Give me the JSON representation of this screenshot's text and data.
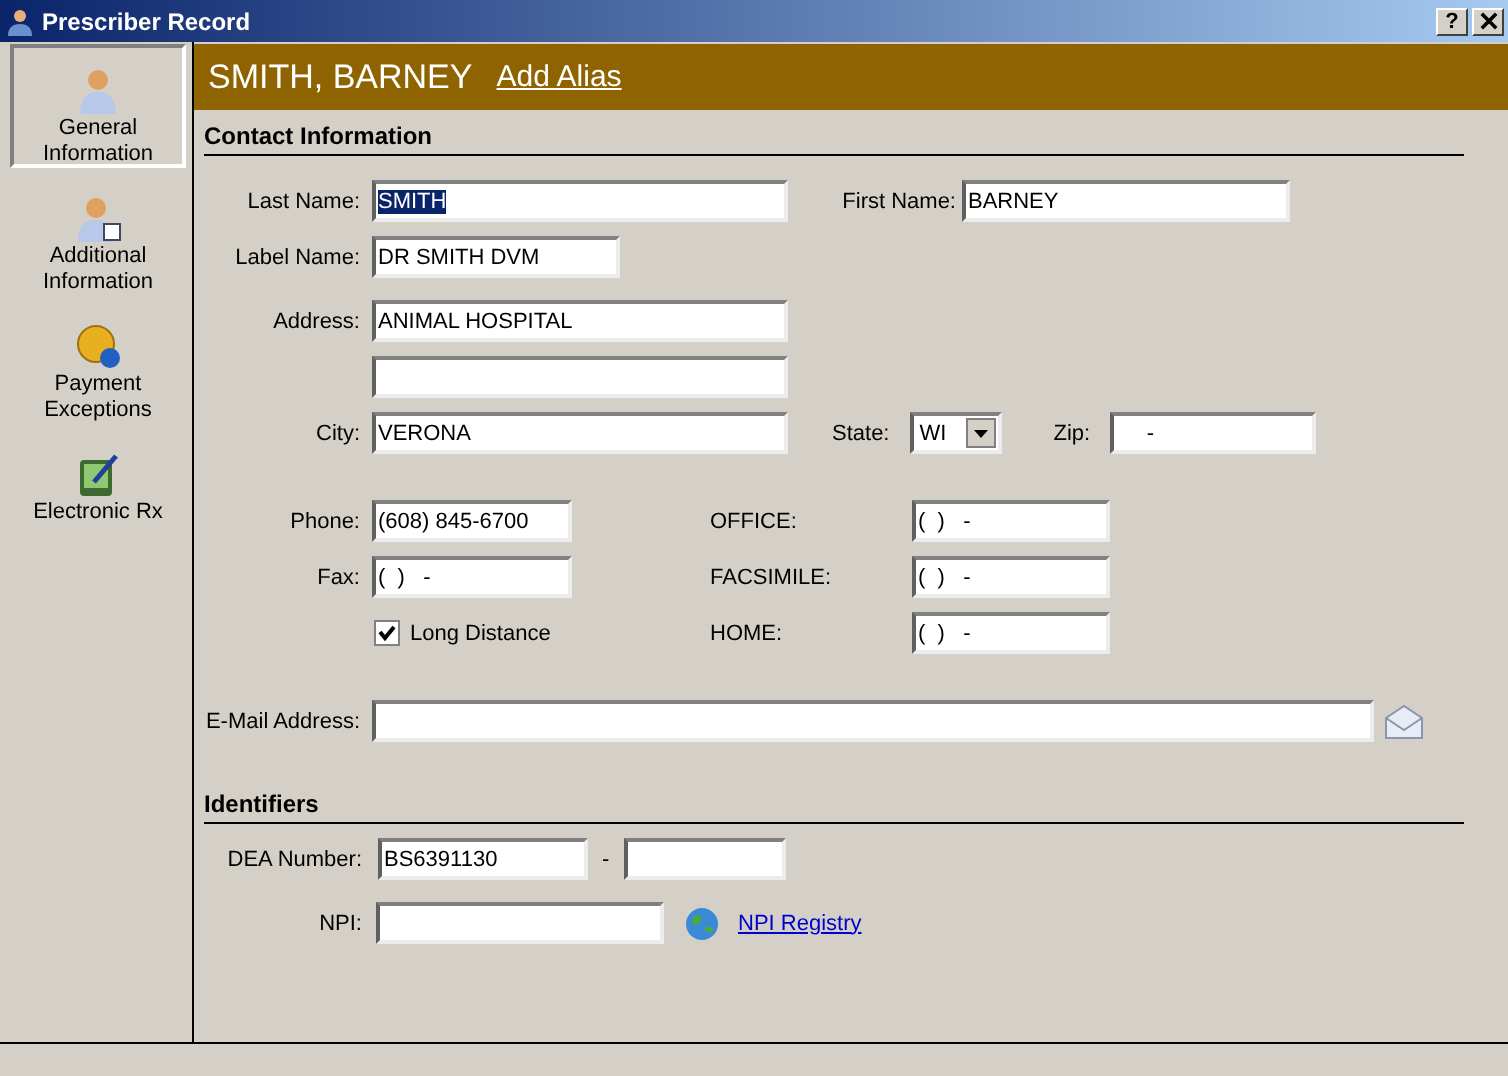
{
  "window": {
    "title": "Prescriber Record",
    "help_button": "?"
  },
  "sidebar": {
    "items": [
      {
        "label": "General Information",
        "selected": true
      },
      {
        "label": "Additional Information",
        "selected": false
      },
      {
        "label": "Payment Exceptions",
        "selected": false
      },
      {
        "label": "Electronic Rx",
        "selected": false
      }
    ]
  },
  "header": {
    "name": "SMITH, BARNEY",
    "link": "Add Alias"
  },
  "contact": {
    "heading": "Contact Information",
    "last_name": {
      "label": "Last Name:",
      "value": "SMITH",
      "highlighted": true
    },
    "first_name": {
      "label": "First Name:",
      "value": "BARNEY"
    },
    "label_name": {
      "label": "Label Name:",
      "value": "DR SMITH DVM"
    },
    "address": {
      "label": "Address:",
      "value": "ANIMAL HOSPITAL"
    },
    "city": {
      "label": "City:",
      "value": "VERONA"
    },
    "state": {
      "label": "State:",
      "value": "WI"
    },
    "zip": {
      "label": "Zip:",
      "value": "     -"
    },
    "phone": {
      "label": "Phone:",
      "value": "(608) 845-6700"
    },
    "fax": {
      "label": "Fax:",
      "value": "(  )   -"
    },
    "long_distance": {
      "label": "Long Distance",
      "checked": true
    },
    "office": {
      "label": "OFFICE:",
      "value": "(  )   -"
    },
    "facsimile": {
      "label": "FACSIMILE:",
      "value": "(  )   -"
    },
    "home": {
      "label": "HOME:",
      "value": "(  )   -"
    },
    "email": {
      "label": "E-Mail Address:"
    }
  },
  "identifiers": {
    "heading": "Identifiers",
    "dea": {
      "label": "DEA Number:",
      "value": "BS6391130",
      "separator": "-"
    },
    "npi": {
      "label": "NPI:",
      "link": "NPI Registry"
    }
  }
}
